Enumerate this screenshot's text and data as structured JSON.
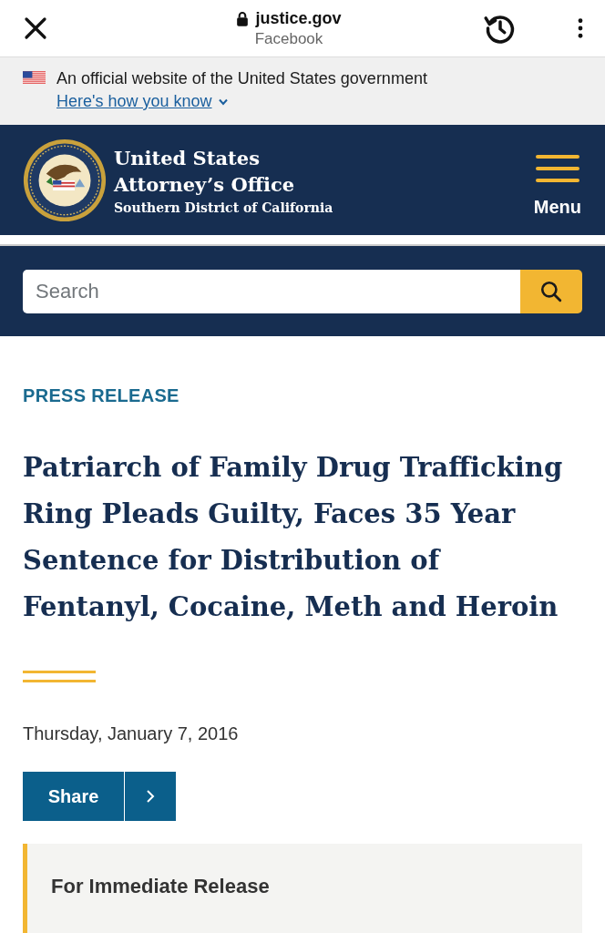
{
  "browser_bar": {
    "domain": "justice.gov",
    "referrer": "Facebook"
  },
  "gov_banner": {
    "text": "An official website of the United States government",
    "link": "Here's how you know",
    "expanded": false
  },
  "header": {
    "title": "United States Attorney’s Office",
    "subtitle": "Southern District of California",
    "menu_label": "Menu"
  },
  "search": {
    "placeholder": "Search"
  },
  "article": {
    "label": "PRESS RELEASE",
    "title": "Patriarch of Family Drug Trafficking Ring Pleads Guilty, Faces 35 Year Sentence for Distribution of Fentanyl, Cocaine, Meth and Heroin",
    "date": "Thursday, January 7, 2016",
    "share_label": "Share",
    "notice_heading": "For Immediate Release"
  }
}
